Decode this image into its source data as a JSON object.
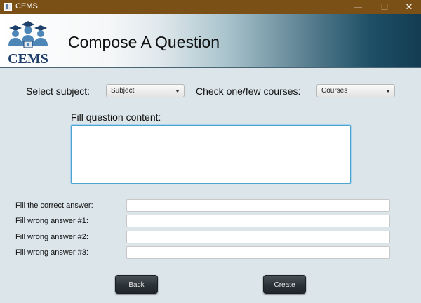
{
  "window": {
    "title": "CEMS",
    "minimize": "—",
    "maximize": "☐",
    "close": "✕"
  },
  "header": {
    "logo_text": "CEMS",
    "page_title": "Compose A Question"
  },
  "form": {
    "subject_label": "Select subject:",
    "subject_value": "Subject",
    "courses_label": "Check one/few courses:",
    "courses_value": "Courses",
    "content_label": "Fill question content:",
    "content_value": "",
    "answers": [
      {
        "label": "Fill the correct answer:",
        "value": ""
      },
      {
        "label": "Fill wrong answer #1:",
        "value": ""
      },
      {
        "label": "Fill wrong answer #2:",
        "value": ""
      },
      {
        "label": "Fill wrong answer #3:",
        "value": ""
      }
    ]
  },
  "buttons": {
    "back": "Back",
    "create": "Create"
  }
}
